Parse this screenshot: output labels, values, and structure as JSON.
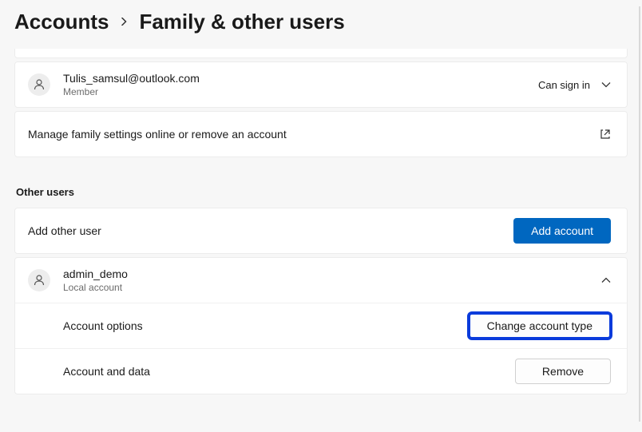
{
  "breadcrumb": {
    "parent": "Accounts",
    "current": "Family & other users"
  },
  "family": {
    "user": {
      "email": "Tulis_samsul@outlook.com",
      "role": "Member",
      "status": "Can sign in"
    },
    "manage_link": "Manage family settings online or remove an account"
  },
  "other_users": {
    "section_label": "Other users",
    "add_label": "Add other user",
    "add_button": "Add account",
    "expanded_user": {
      "name": "admin_demo",
      "type": "Local account",
      "options_row": {
        "label": "Account options",
        "button": "Change account type"
      },
      "data_row": {
        "label": "Account and data",
        "button": "Remove"
      }
    }
  }
}
